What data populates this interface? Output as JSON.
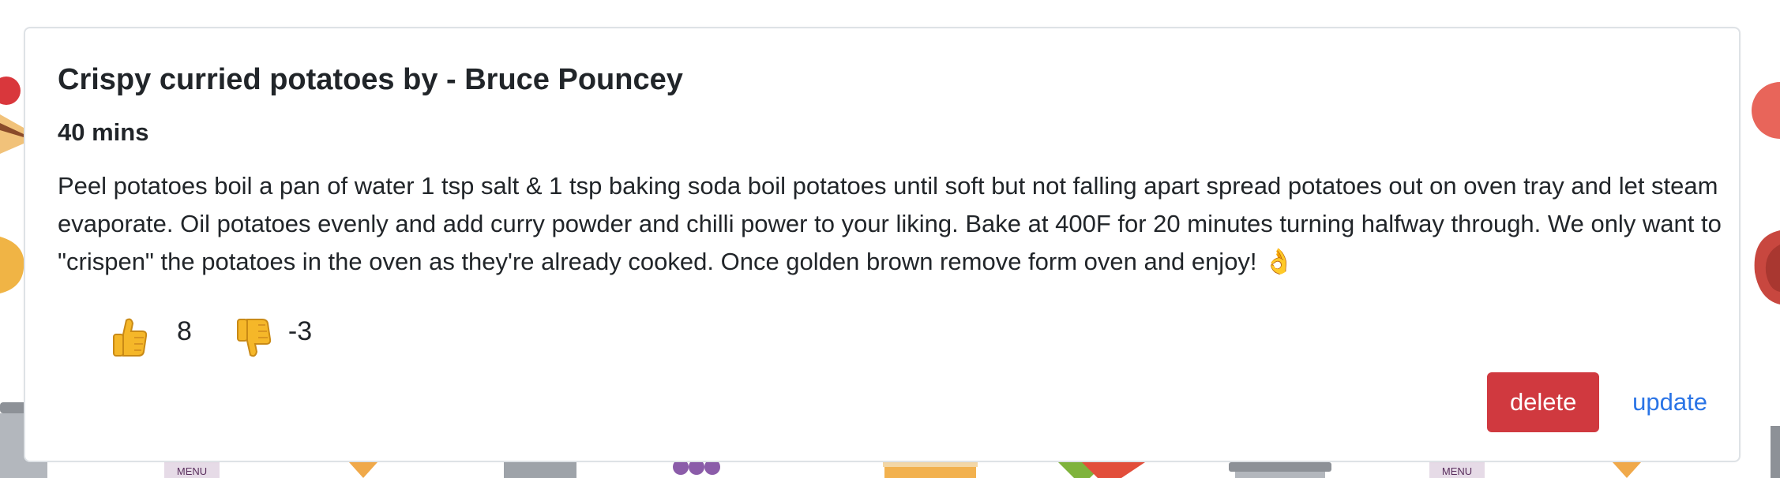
{
  "recipe": {
    "title": "Crispy curried potatoes by - Bruce Pouncey",
    "time": "40 mins",
    "instructions": "Peel potatoes boil a pan of water 1 tsp salt & 1 tsp baking soda boil potatoes until soft but not falling apart spread potatoes out on oven tray and let steam evaporate. Oil potatoes evenly and add curry powder and chilli power to your liking. Bake at 400F for 20 minutes turning halfway through. We only want to \"crispen\" the potatoes in the oven as they're already cooked. Once golden brown remove form oven and enjoy! 👌"
  },
  "votes": {
    "up_icon": "thumbs-up-icon",
    "up_count": "8",
    "down_icon": "thumbs-down-icon",
    "down_count": "-3"
  },
  "actions": {
    "delete_label": "delete",
    "update_label": "update"
  },
  "colors": {
    "delete_bg": "#d0393f",
    "update_link": "#2a74e6",
    "card_border": "#dee2e6",
    "text": "#212529"
  },
  "background": {
    "menu_labels": [
      "MENU",
      "MENU"
    ]
  }
}
